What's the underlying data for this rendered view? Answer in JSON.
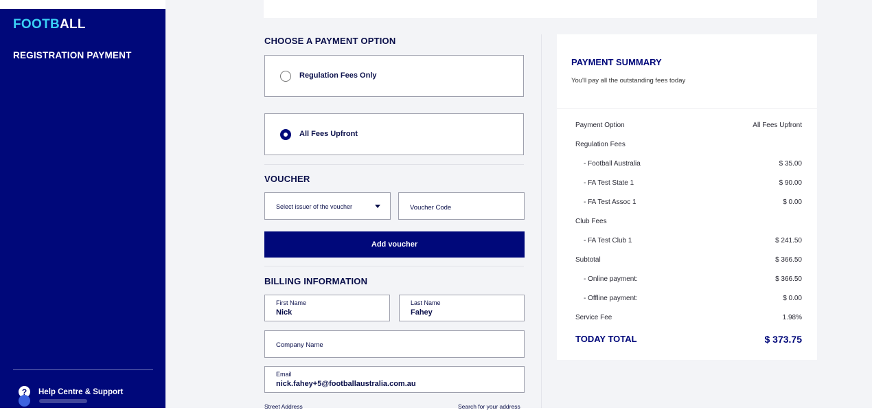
{
  "sidebar": {
    "logo_part1": "FOOTB",
    "logo_part2": "ALL",
    "title": "REGISTRATION PAYMENT",
    "help_label": "Help Centre & Support"
  },
  "payment_option": {
    "title": "CHOOSE A PAYMENT OPTION",
    "options": [
      {
        "label": "Regulation Fees Only",
        "selected": false
      },
      {
        "label": "All Fees Upfront",
        "selected": true
      }
    ]
  },
  "voucher": {
    "title": "VOUCHER",
    "issuer_select": "Select issuer of the voucher",
    "code_placeholder": "Voucher Code",
    "add_button": "Add voucher"
  },
  "billing": {
    "title": "BILLING INFORMATION",
    "first_name_label": "First Name",
    "first_name_value": "Nick",
    "last_name_label": "Last Name",
    "last_name_value": "Fahey",
    "company_placeholder": "Company Name",
    "email_label": "Email",
    "email_value": "nick.fahey+5@footballaustralia.com.au",
    "street_label": "Street Address",
    "search_address": "Search for your address"
  },
  "summary": {
    "title": "PAYMENT SUMMARY",
    "subtitle": "You'll pay all the outstanding fees today",
    "rows": [
      {
        "label": "Payment Option",
        "value": "All Fees Upfront",
        "indent": false
      },
      {
        "label": "Regulation Fees",
        "value": "",
        "indent": false
      },
      {
        "label": "- Football Australia",
        "value": "$ 35.00",
        "indent": true
      },
      {
        "label": "- FA Test State 1",
        "value": "$ 90.00",
        "indent": true
      },
      {
        "label": "- FA Test Assoc 1",
        "value": "$ 0.00",
        "indent": true
      },
      {
        "label": "Club Fees",
        "value": "",
        "indent": false
      },
      {
        "label": "- FA Test Club 1",
        "value": "$ 241.50",
        "indent": true
      },
      {
        "label": "Subtotal",
        "value": "$ 366.50",
        "indent": false
      },
      {
        "label": "- Online payment:",
        "value": "$ 366.50",
        "indent": true
      },
      {
        "label": "- Offline payment:",
        "value": "$ 0.00",
        "indent": true
      },
      {
        "label": "Service Fee",
        "value": "1.98%",
        "indent": false
      }
    ],
    "total_label": "TODAY TOTAL",
    "total_value": "$ 373.75"
  },
  "colors": {
    "brand_navy": "#00087a",
    "logo_accent": "#3ad0f5"
  }
}
